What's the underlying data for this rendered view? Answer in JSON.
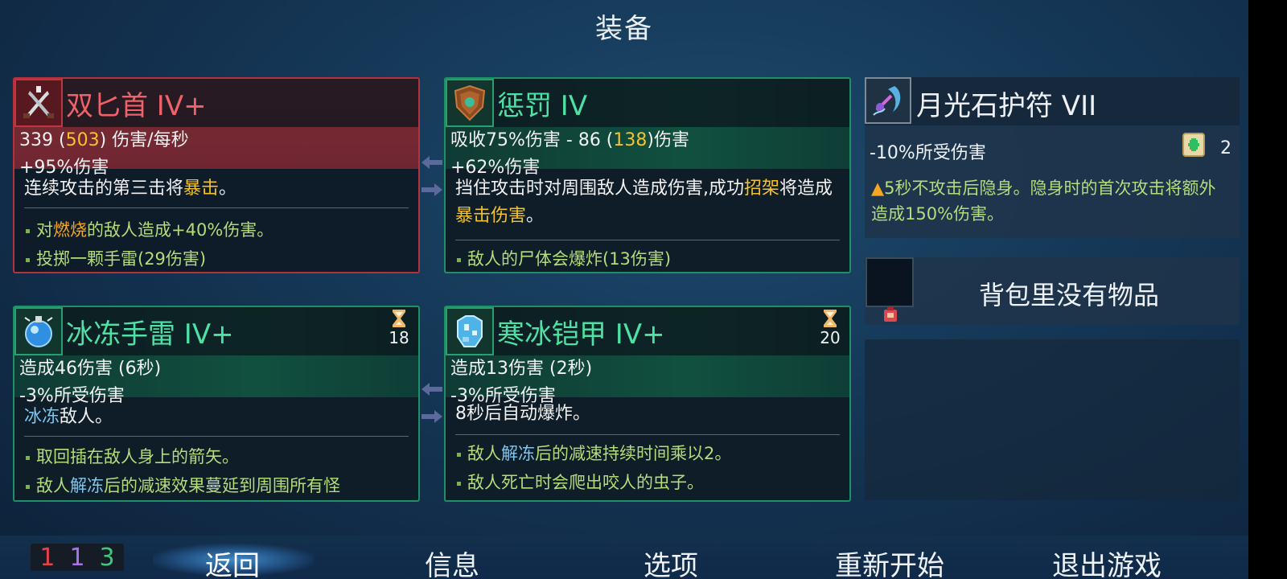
{
  "screen_title": "装备",
  "weapons": [
    {
      "name": "双匕首 IV+",
      "stat_main": "339",
      "stat_paren": "503",
      "stat_unit": "伤害/每秒",
      "stat_bonus": "+95%伤害",
      "desc_pre": "连续攻击的第三击将",
      "desc_kw": "暴击",
      "desc_post": "。",
      "bullets": [
        {
          "pre": "对",
          "kw": "燃烧",
          "post": "的敌人造成+40%伤害。"
        },
        {
          "pre": "投掷一颗手雷(29伤害)",
          "kw": "",
          "post": ""
        }
      ]
    },
    {
      "name": "惩罚 IV",
      "stat_pre": "吸收75%伤害 - 86 (",
      "stat_paren": "138",
      "stat_post": ")伤害",
      "stat_bonus": "+62%伤害",
      "desc_pre": "挡住攻击时对周围敌人造成伤害,成功",
      "desc_kw1": "招架",
      "desc_mid": "将造成",
      "desc_kw2": "暴击伤害",
      "desc_post": "。",
      "bullets": [
        {
          "text": "敌人的尸体会爆炸(13伤害)"
        }
      ]
    }
  ],
  "skills": [
    {
      "name": "冰冻手雷 IV+",
      "cooldown": "18",
      "stat1": "造成46伤害 (6秒)",
      "stat2": "-3%所受伤害",
      "desc_kw": "冰冻",
      "desc_post": "敌人。",
      "bullets": [
        {
          "pre": "取回插在敌人身上的箭矢。",
          "kw": "",
          "post": ""
        },
        {
          "pre": "敌人",
          "kw": "解冻",
          "post": "后的减速效果蔓延到周围所有怪"
        }
      ]
    },
    {
      "name": "寒冰铠甲 IV+",
      "cooldown": "20",
      "stat1": "造成13伤害 (2秒)",
      "stat2": "-3%所受伤害",
      "desc": "8秒后自动爆炸。",
      "bullets": [
        {
          "pre": "敌人",
          "kw": "解冻",
          "post": "后的减速持续时间乘以2。"
        },
        {
          "pre": "敌人死亡时会爬出咬人的虫子。",
          "kw": "",
          "post": ""
        }
      ]
    }
  ],
  "amulet": {
    "name": "月光石护符 VII",
    "stat": "-10%所受伤害",
    "scroll_count": "2",
    "desc": "5秒不攻击后隐身。隐身时的首次攻击将额外造成150%伤害。"
  },
  "backpack": {
    "empty_text": "背包里没有物品"
  },
  "counters": {
    "red": "1",
    "purple": "1",
    "green": "3"
  },
  "nav": {
    "back": "返回",
    "info": "信息",
    "options": "选项",
    "restart": "重新开始",
    "quit": "退出游戏"
  },
  "colors": {
    "brutality": "#e6424b",
    "tactics": "#a773e8",
    "survival": "#3fc77f",
    "keyword_orange": "#f5a623",
    "keyword_blue": "#7fc6ef",
    "keyword_yellow": "#f5c32c",
    "bullet_text": "#b5dc7a"
  }
}
